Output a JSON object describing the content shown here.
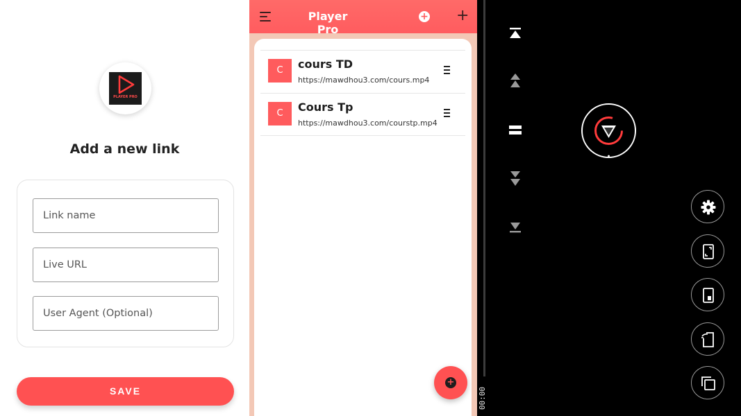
{
  "add_link": {
    "logo_text": "PLAYER PRO",
    "title": "Add a new link",
    "fields": {
      "link_name": {
        "placeholder": "Link name",
        "value": ""
      },
      "live_url": {
        "placeholder": "Live URL",
        "value": ""
      },
      "user_agent": {
        "placeholder": "User Agent (Optional)",
        "value": ""
      }
    },
    "save_label": "SAVE"
  },
  "list_screen": {
    "app_title": "Player Pro",
    "items": [
      {
        "avatar": "C",
        "title": "cours TD",
        "url": "https://mawdhou3.com/cours.mp4"
      },
      {
        "avatar": "C",
        "title": "Cours Tp",
        "url": "https://mawdhou3.com/courstp.mp4"
      }
    ]
  },
  "player": {
    "time": "00:00",
    "icons": {
      "left_controls": [
        "skip-to-top-icon",
        "seek-up-icon",
        "pause-icon",
        "seek-down-icon",
        "skip-to-bottom-icon"
      ],
      "right_controls": [
        "gear-icon",
        "fit-screen-icon",
        "picture-in-picture-icon",
        "rotate-screen-icon",
        "copy-window-icon"
      ]
    }
  },
  "colors": {
    "accent": "#ff5152",
    "appbar": "#ff6063",
    "player_bg": "#000000"
  }
}
